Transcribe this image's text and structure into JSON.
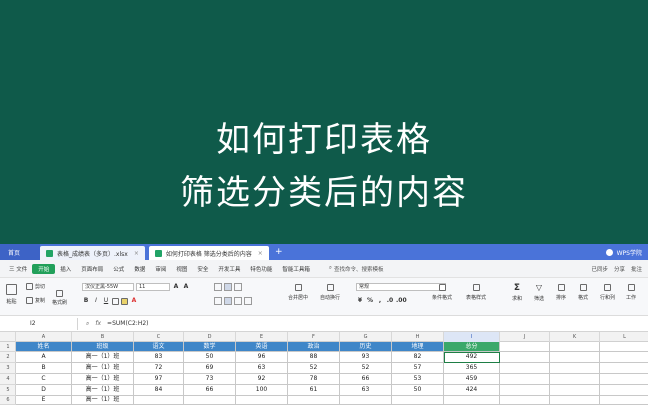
{
  "overlay": {
    "line1": "如何打印表格",
    "line2": "筛选分类后的内容"
  },
  "tabbar": {
    "home": "首页",
    "tabs": [
      {
        "label": "表格_成绩表（多页）.xlsx",
        "close": "×"
      },
      {
        "label": "如何打印表格 筛选分类后的内容",
        "close": "×"
      }
    ],
    "add": "+",
    "account": "WPS学院"
  },
  "menubar": {
    "file": "三 文件",
    "items": [
      "开始",
      "插入",
      "页面布局",
      "公式",
      "数据",
      "审阅",
      "视图",
      "安全",
      "开发工具",
      "特色功能",
      "智能工具箱"
    ],
    "search": "查找命令、搜索模板",
    "right": [
      "已同步",
      "分享",
      "批注"
    ]
  },
  "ribbon": {
    "paste": "粘贴",
    "cut": "剪切",
    "copy": "复制",
    "format_painter": "格式刷",
    "font_name": "汉仪正黑-55W",
    "font_size": "11",
    "merge": "合并居中",
    "wrap": "自动换行",
    "number_format": "常规",
    "cond_format": "条件格式",
    "table_style": "表格样式",
    "sum": "求和",
    "filter": "筛选",
    "sort": "排序",
    "format": "格式",
    "rows_cols": "行和列",
    "sheet": "工作"
  },
  "formula_bar": {
    "cell": "I2",
    "formula": "=SUM(C2:H2)"
  },
  "sheet": {
    "columns": [
      "A",
      "B",
      "C",
      "D",
      "E",
      "F",
      "G",
      "H",
      "I",
      "J",
      "K",
      "L"
    ],
    "rows": [
      "1",
      "2",
      "3",
      "4",
      "5",
      "6"
    ],
    "header": [
      "姓名",
      "班级",
      "语文",
      "数学",
      "英语",
      "政治",
      "历史",
      "地理",
      "总分"
    ],
    "data": [
      [
        "A",
        "高一（1）班",
        "83",
        "50",
        "96",
        "88",
        "93",
        "82",
        "492"
      ],
      [
        "B",
        "高一（1）班",
        "72",
        "69",
        "63",
        "52",
        "52",
        "57",
        "365"
      ],
      [
        "C",
        "高一（1）班",
        "97",
        "73",
        "92",
        "78",
        "66",
        "53",
        "459"
      ],
      [
        "D",
        "高一（1）班",
        "84",
        "66",
        "100",
        "61",
        "63",
        "50",
        "424"
      ],
      [
        "E",
        "高一（1）班",
        "",
        "",
        "",
        "",
        "",
        "",
        ""
      ]
    ]
  },
  "colors": {
    "overlay_bg": "#0f5a4a",
    "tabbar_bg": "#4a73d9",
    "header_blue": "#3f86c8",
    "header_green": "#3aa86a",
    "start_green": "#22a05a"
  }
}
